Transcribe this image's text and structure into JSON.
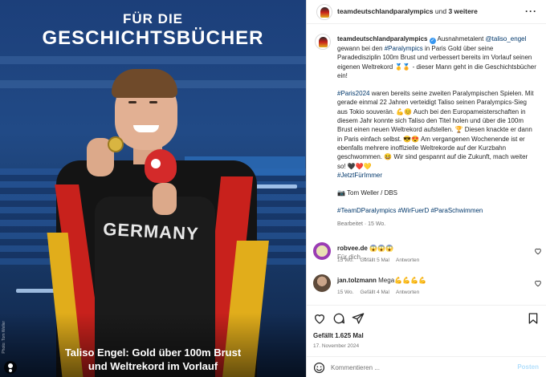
{
  "image": {
    "headline_line1": "FÜR DIE",
    "headline_line2": "GESCHICHTSBÜCHER",
    "shirt_text": "GERMANY",
    "caption_line1": "Taliso Engel: Gold über 100m Brust",
    "caption_line2": "und Weltrekord im Vorlauf",
    "photo_credit": "Photo: Tom Weller"
  },
  "header": {
    "account": "teamdeutschlandparalympics",
    "connector": "und",
    "others": "3 weitere",
    "more_icon": "more-horizontal-icon"
  },
  "post": {
    "author": "teamdeutschlandparalympics",
    "verified": "✓",
    "p1_a": " Ausnahmetalent ",
    "p1_mention": "@taliso_engel",
    "p1_b": " gewann bei den ",
    "p1_tag": "#Paralympics",
    "p1_c": " in Paris Gold über seine Paradedisziplin 100m Brust und verbessert bereits im Vorlauf seinen eigenen Weltrekord 🥇🏅 - dieser Mann geht in die Geschichtsbücher ein!",
    "p2_tag": "#Paris2024",
    "p2_text": " waren bereits seine zweiten Paralympischen Spielen. Mit gerade einmal 22 Jahren verteidigt Taliso seinen Paralympics-Sieg aus Tokio souverän. 💪😊 Auch bei den Europameisterschaften in diesem Jahr konnte sich Taliso den Titel holen und über die 100m Brust einen neuen Weltrekord aufstellen. 🏆 Diesen knackte er dann in Paris einfach selbst. 😎😍 Am vergangenen Wochenende ist er ebenfalls mehrere inoffizielle Weltrekorde auf der Kurzbahn geschwommen. 😆 Wir sind gespannt auf die Zukunft, mach weiter so! 🖤❤️💛",
    "p2_tag2": "#JetztFürImmer",
    "credit": "📷 Tom Weller / DBS",
    "hashtags": "#TeamDParalympics #WirFuerD #ParaSchwimmen",
    "edited": "Bearbeitet · 15 Wo.",
    "translate": "Für dich"
  },
  "comments": [
    {
      "user": "robvee.de",
      "text": "😱😱😱",
      "age": "15 Wo.",
      "likes": "Gefällt 5 Mal",
      "reply": "Antworten"
    },
    {
      "user": "jan.tolzmann",
      "text": "Mega💪💪💪💪",
      "age": "15 Wo.",
      "likes": "Gefällt 4 Mal",
      "reply": "Antworten"
    }
  ],
  "actions": {
    "likes": "Gefällt 1.625 Mal",
    "date": "17. November 2024",
    "comment_placeholder": "Kommentieren ...",
    "post_label": "Posten"
  },
  "colors": {
    "link": "#00376b",
    "verified": "#3797f0",
    "muted": "#737373",
    "flag_black": "#141414",
    "flag_red": "#c8211c",
    "flag_gold": "#e1ad1b"
  },
  "icons": [
    "heart-icon",
    "comment-icon",
    "share-icon",
    "bookmark-icon",
    "emoji-icon",
    "more-horizontal-icon",
    "verified-icon"
  ]
}
